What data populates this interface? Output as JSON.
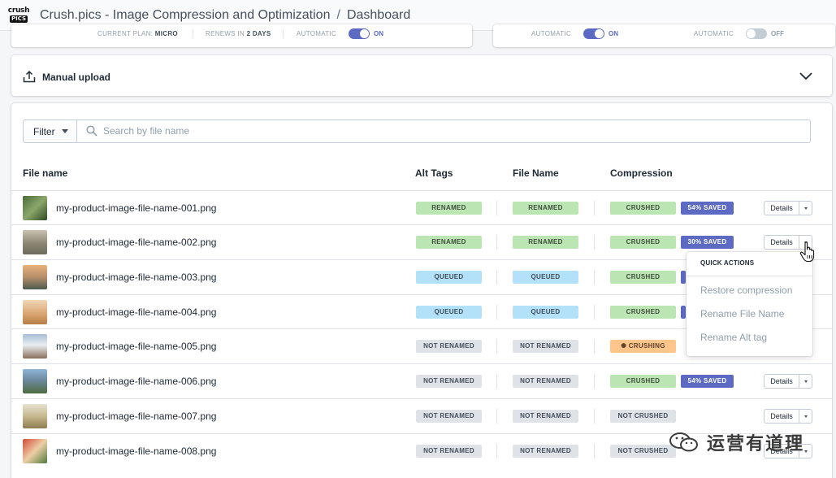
{
  "header": {
    "logo_top": "crush",
    "logo_bottom": "PICS",
    "app_title": "Crush.pics - Image Compression and Optimization",
    "separator": "/",
    "page": "Dashboard"
  },
  "plan_bar": {
    "current_plan_label": "CURRENT PLAN:",
    "current_plan_value": "MICRO",
    "renews_label": "RENEWS IN",
    "renews_value": "2 DAYS",
    "automatic_label": "AUTOMATIC",
    "automatic_state": "ON"
  },
  "auto_bar": {
    "toggle1_label": "AUTOMATIC",
    "toggle1_state": "ON",
    "toggle2_label": "AUTOMATIC",
    "toggle2_state": "OFF"
  },
  "upload": {
    "label": "Manual upload"
  },
  "filter": {
    "button": "Filter",
    "placeholder": "Search by file name"
  },
  "table": {
    "columns": [
      "File name",
      "Alt Tags",
      "File Name",
      "Compression"
    ],
    "details_label": "Details",
    "rows": [
      {
        "file": "my-product-image-file-name-001.png",
        "alt": "RENAMED",
        "name": "RENAMED",
        "compression": "CRUSHED",
        "saved": "54% SAVED",
        "details": true
      },
      {
        "file": "my-product-image-file-name-002.png",
        "alt": "RENAMED",
        "name": "RENAMED",
        "compression": "CRUSHED",
        "saved": "30% SAVED",
        "details": true
      },
      {
        "file": "my-product-image-file-name-003.png",
        "alt": "QUEUED",
        "name": "QUEUED",
        "compression": "CRUSHED",
        "saved": "",
        "details": false
      },
      {
        "file": "my-product-image-file-name-004.png",
        "alt": "QUEUED",
        "name": "QUEUED",
        "compression": "CRUSHED",
        "saved": "",
        "details": false
      },
      {
        "file": "my-product-image-file-name-005.png",
        "alt": "NOT RENAMED",
        "name": "NOT RENAMED",
        "compression": "CRUSHING",
        "saved": "",
        "details": false
      },
      {
        "file": "my-product-image-file-name-006.png",
        "alt": "NOT RENAMED",
        "name": "NOT RENAMED",
        "compression": "CRUSHED",
        "saved": "54% SAVED",
        "details": true
      },
      {
        "file": "my-product-image-file-name-007.png",
        "alt": "NOT RENAMED",
        "name": "NOT RENAMED",
        "compression": "NOT CRUSHED",
        "saved": "",
        "details": true
      },
      {
        "file": "my-product-image-file-name-008.png",
        "alt": "NOT RENAMED",
        "name": "NOT RENAMED",
        "compression": "NOT CRUSHED",
        "saved": "",
        "details": true
      }
    ]
  },
  "quick_actions": {
    "title": "QUICK ACTIONS",
    "items": [
      "Restore compression",
      "Rename File Name",
      "Rename Alt tag"
    ]
  },
  "watermark": {
    "text": "运营有道理"
  },
  "colors": {
    "accent": "#5c6ac4",
    "success": "#bbe5b3",
    "info": "#b4e1fa",
    "warning": "#ffc58b",
    "neutral": "#dfe3e8"
  }
}
